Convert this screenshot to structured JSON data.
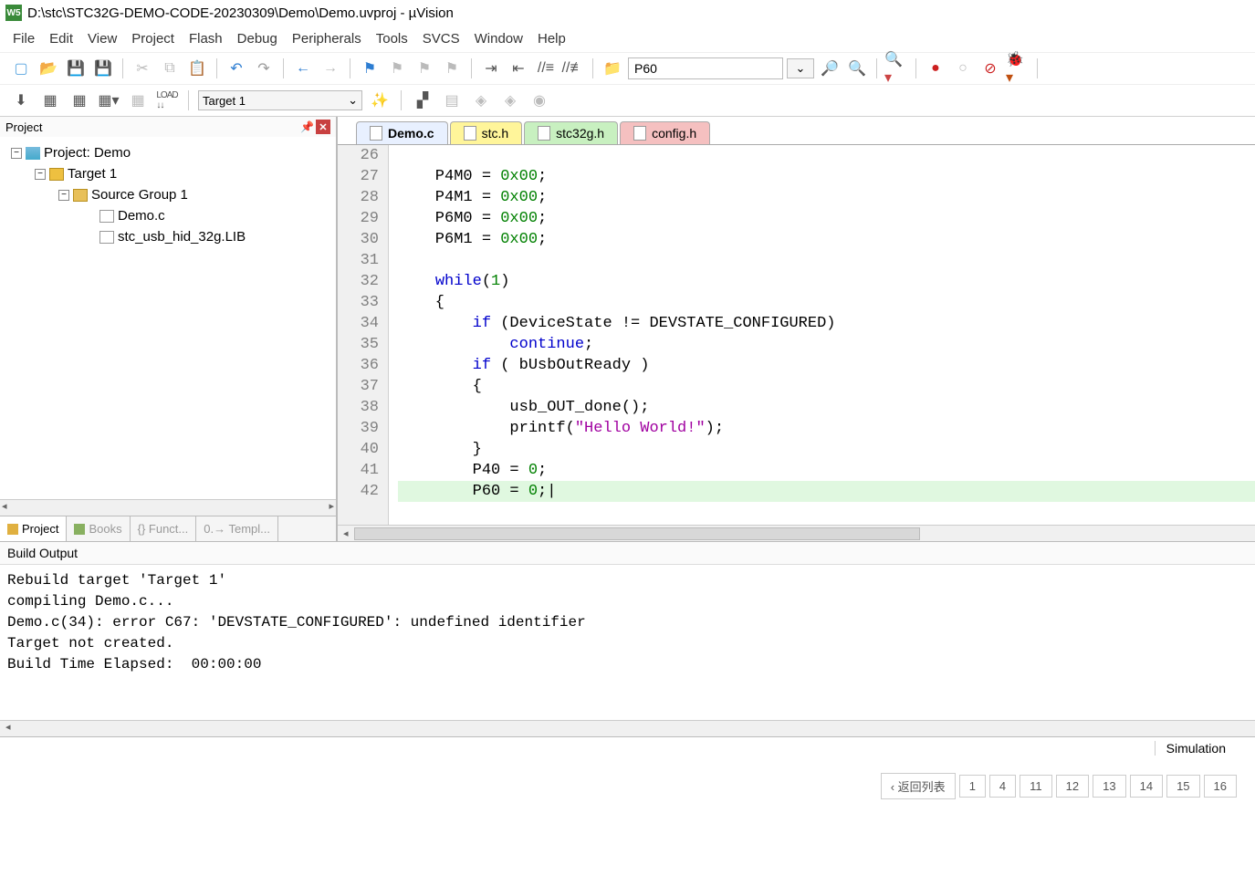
{
  "title": "D:\\stc\\STC32G-DEMO-CODE-20230309\\Demo\\Demo.uvproj - µVision",
  "menu": [
    "File",
    "Edit",
    "View",
    "Project",
    "Flash",
    "Debug",
    "Peripherals",
    "Tools",
    "SVCS",
    "Window",
    "Help"
  ],
  "find_box": "P60",
  "target_combo": "Target 1",
  "project_panel": {
    "title": "Project",
    "root": "Project: Demo",
    "target": "Target 1",
    "group": "Source Group 1",
    "files": [
      "Demo.c",
      "stc_usb_hid_32g.LIB"
    ]
  },
  "project_tabs": {
    "project": "Project",
    "books": "Books",
    "functions": "{} Funct...",
    "templates": "0.→ Templ..."
  },
  "file_tabs": [
    {
      "label": "Demo.c",
      "state": "active"
    },
    {
      "label": "stc.h",
      "state": "yellow"
    },
    {
      "label": "stc32g.h",
      "state": "green"
    },
    {
      "label": "config.h",
      "state": "red"
    }
  ],
  "code": {
    "first_line": 26,
    "lines": [
      {
        "n": 26,
        "html": ""
      },
      {
        "n": 27,
        "html": "    P4M0 = <span class='num'>0x00</span>;"
      },
      {
        "n": 28,
        "html": "    P4M1 = <span class='num'>0x00</span>;"
      },
      {
        "n": 29,
        "html": "    P6M0 = <span class='num'>0x00</span>;"
      },
      {
        "n": 30,
        "html": "    P6M1 = <span class='num'>0x00</span>;"
      },
      {
        "n": 31,
        "html": ""
      },
      {
        "n": 32,
        "html": "    <span class='kw'>while</span>(<span class='num'>1</span>)"
      },
      {
        "n": 33,
        "html": "    {"
      },
      {
        "n": 34,
        "html": "        <span class='kw'>if</span> (DeviceState != DEVSTATE_CONFIGURED)"
      },
      {
        "n": 35,
        "html": "            <span class='kw'>continue</span>;"
      },
      {
        "n": 36,
        "html": "        <span class='kw'>if</span> ( bUsbOutReady )"
      },
      {
        "n": 37,
        "html": "        {"
      },
      {
        "n": 38,
        "html": "            usb_OUT_done();"
      },
      {
        "n": 39,
        "html": "            printf(<span class='str'>\"Hello World!\"</span>);"
      },
      {
        "n": 40,
        "html": "        }"
      },
      {
        "n": 41,
        "html": "        P40 = <span class='num'>0</span>;"
      },
      {
        "n": 42,
        "html": "        P60 = <span class='num'>0</span>;|",
        "hl": true
      }
    ]
  },
  "build": {
    "title": "Build Output",
    "lines": [
      "Rebuild target 'Target 1'",
      "compiling Demo.c...",
      "Demo.c(34): error C67: 'DEVSTATE_CONFIGURED': undefined identifier",
      "Target not created.",
      "Build Time Elapsed:  00:00:00"
    ]
  },
  "status": {
    "sim": "Simulation"
  },
  "pager": {
    "back": "‹ 返回列表",
    "pages": [
      "1",
      "4",
      "11",
      "12",
      "13",
      "14",
      "15",
      "16"
    ]
  }
}
